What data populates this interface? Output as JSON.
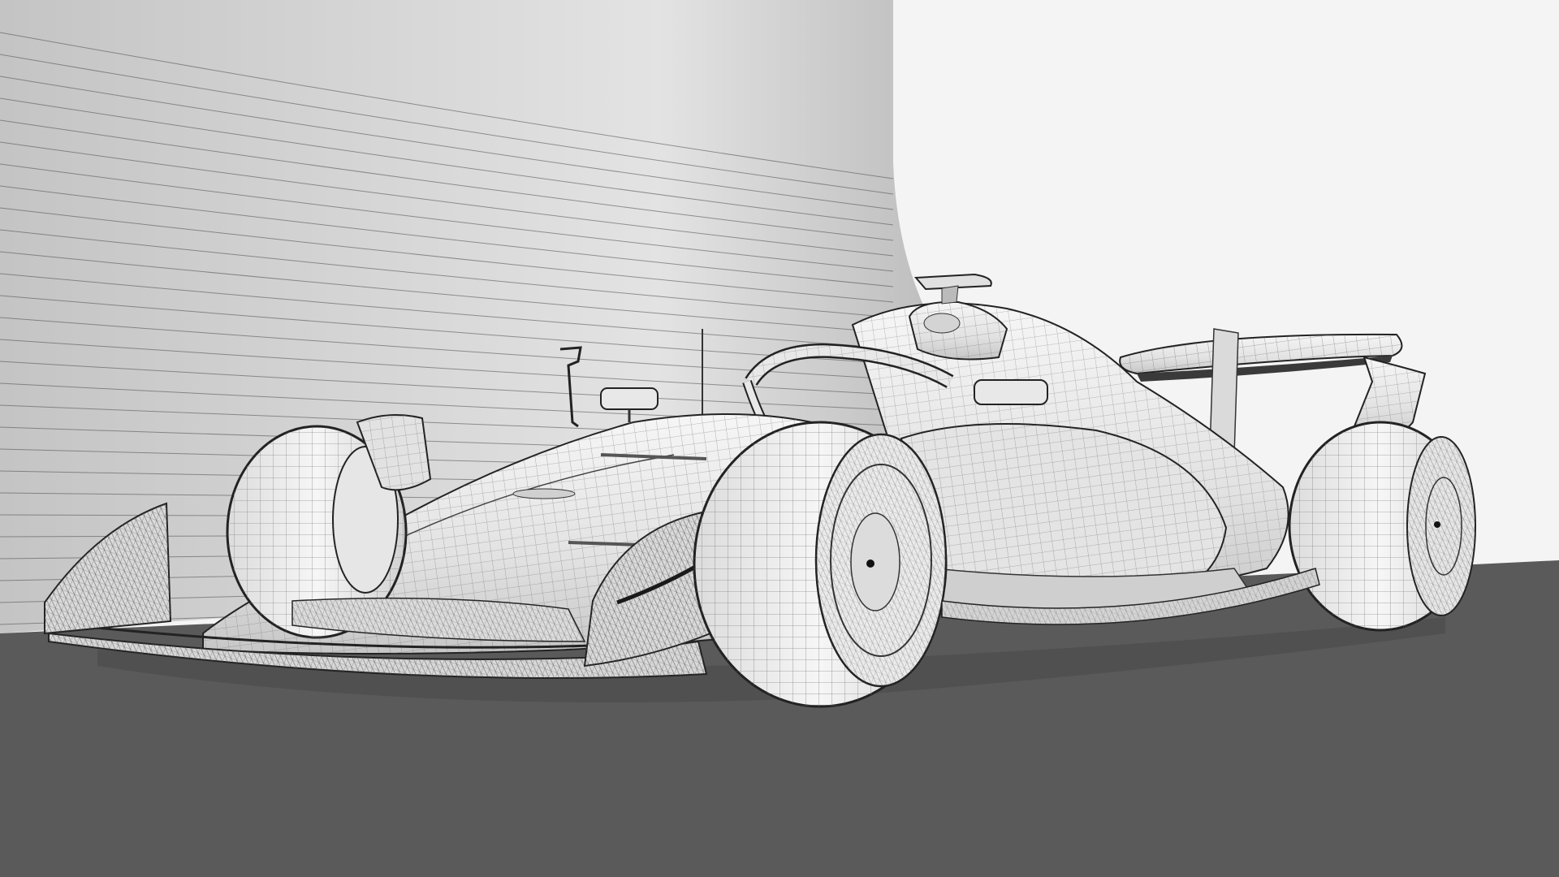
{
  "scene": {
    "subject": "formula-one-car",
    "render_style": "wireframe-mesh",
    "colors": {
      "backdrop_light": "#f4f4f4",
      "backdrop_wall_dark": "#b9b9b9",
      "backdrop_wall_light": "#e6e6e6",
      "floor": "#5a5a5a",
      "body_fill": "#ececec",
      "body_shade": "#c8c8c8",
      "mesh_line": "#5e5e5e",
      "outline": "#1e1e1e",
      "tire_fill": "#efefef"
    }
  }
}
